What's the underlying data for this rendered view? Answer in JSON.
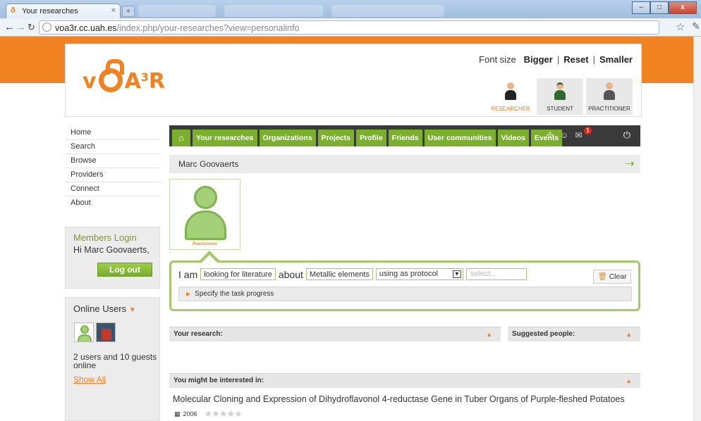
{
  "browser": {
    "tab_title": "Your researches",
    "tab_close": "×",
    "new_tab": "+",
    "url_host": "voa3r.cc.uah.es",
    "url_path": "/index.php/your-researches?view=personalinfo",
    "win_min": "–",
    "win_max": "□",
    "win_close": "x"
  },
  "header": {
    "logo_text_v": "v",
    "logo_text_a": "A",
    "logo_sup": "3",
    "logo_text_r": "R",
    "font_size_label": "Font size",
    "bigger": "Bigger",
    "reset": "Reset",
    "smaller": "Smaller",
    "sep": "|",
    "roles": [
      {
        "label": "RESEARCHER",
        "selected": true
      },
      {
        "label": "STUDENT",
        "selected": false
      },
      {
        "label": "PRACTITIONER",
        "selected": false
      }
    ]
  },
  "left_nav": {
    "items": [
      "Home",
      "Search",
      "Browse",
      "Providers",
      "Connect",
      "About"
    ]
  },
  "login": {
    "title": "Members Login",
    "greeting": "Hi Marc Goovaerts,",
    "logout": "Log out"
  },
  "online": {
    "title": "Online Users",
    "caret": "▼",
    "count_text": "2 users and 10 guests online",
    "show_all": "Show All"
  },
  "main_nav": {
    "home_icon": "⌂",
    "tabs": [
      "Your researches",
      "Organizations",
      "Projects",
      "Profile",
      "Friends",
      "User communities",
      "Videos",
      "Events"
    ],
    "mail_badge": "1",
    "power_icon": "⏻"
  },
  "profile": {
    "name": "Marc Goovaerts",
    "picture_caption": "Practicioner"
  },
  "task": {
    "i_am": "I am",
    "action": "looking for literature",
    "about": "about",
    "topic": "Metallic elements",
    "protocol": "using as protocol",
    "select_placeholder": "select...",
    "clear": "Clear",
    "specify": "Specify the task progress"
  },
  "sections": {
    "your_research": "Your research:",
    "suggested_people": "Suggested people:",
    "might_interest": "You might be interested in:"
  },
  "article": {
    "title": "Molecular Cloning and Expression of Dihydroflavonol 4-reductase Gene in Tuber Organs of Purple-fleshed Potatoes",
    "year": "2006",
    "stars": "★★★★★"
  },
  "colors": {
    "orange": "#f08221",
    "green": "#7bb02d",
    "dark_nav": "#3a3a3a"
  }
}
